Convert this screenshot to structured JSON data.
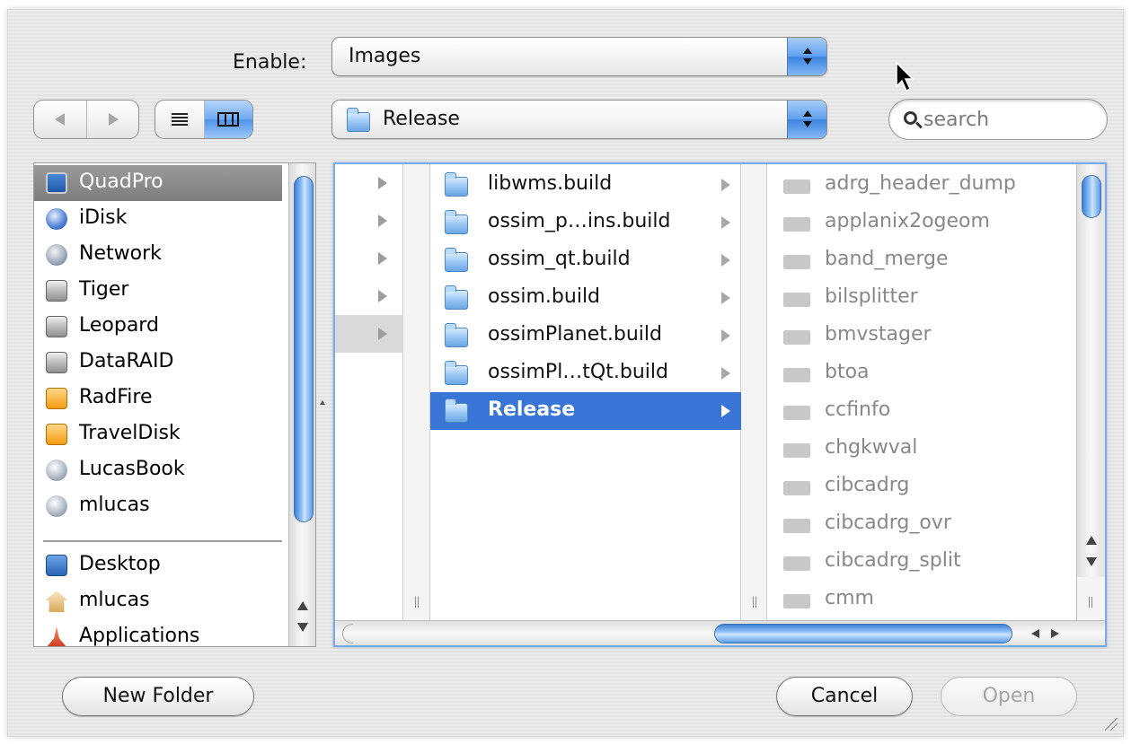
{
  "enable_row": {
    "label": "Enable:",
    "selected": "Images"
  },
  "toolbar": {
    "location_selected": "Release",
    "search_placeholder": "search"
  },
  "sidebar": {
    "devices": [
      {
        "label": "QuadPro",
        "icon": "computer-icon",
        "selected": true
      },
      {
        "label": "iDisk",
        "icon": "idisk-icon"
      },
      {
        "label": "Network",
        "icon": "network-icon"
      },
      {
        "label": "Tiger",
        "icon": "hard-disk-icon"
      },
      {
        "label": "Leopard",
        "icon": "hard-disk-icon"
      },
      {
        "label": "DataRAID",
        "icon": "hard-disk-icon"
      },
      {
        "label": "RadFire",
        "icon": "external-disk-icon"
      },
      {
        "label": "TravelDisk",
        "icon": "external-disk-icon"
      },
      {
        "label": "LucasBook",
        "icon": "shared-computer-icon"
      },
      {
        "label": "mlucas",
        "icon": "shared-computer-icon"
      }
    ],
    "places": [
      {
        "label": "Desktop",
        "icon": "desktop-icon"
      },
      {
        "label": "mlucas",
        "icon": "home-icon"
      },
      {
        "label": "Applications",
        "icon": "applications-icon"
      }
    ]
  },
  "browser": {
    "column2": [
      {
        "label": "libwms.build"
      },
      {
        "label": "ossim_p…ins.build"
      },
      {
        "label": "ossim_qt.build"
      },
      {
        "label": "ossim.build"
      },
      {
        "label": "ossimPlanet.build"
      },
      {
        "label": "ossimPl…tQt.build"
      },
      {
        "label": "Release",
        "selected": true
      }
    ],
    "column3": [
      "adrg_header_dump",
      "applanix2ogeom",
      "band_merge",
      "bilsplitter",
      "bmvstager",
      "btoa",
      "ccfinfo",
      "chgkwval",
      "cibcadrg",
      "cibcadrg_ovr",
      "cibcadrg_split",
      "cmm"
    ]
  },
  "buttons": {
    "new_folder": "New Folder",
    "cancel": "Cancel",
    "open": "Open"
  },
  "colors": {
    "selection": "#3875d7",
    "accent_blue": "#5e9ff0"
  }
}
